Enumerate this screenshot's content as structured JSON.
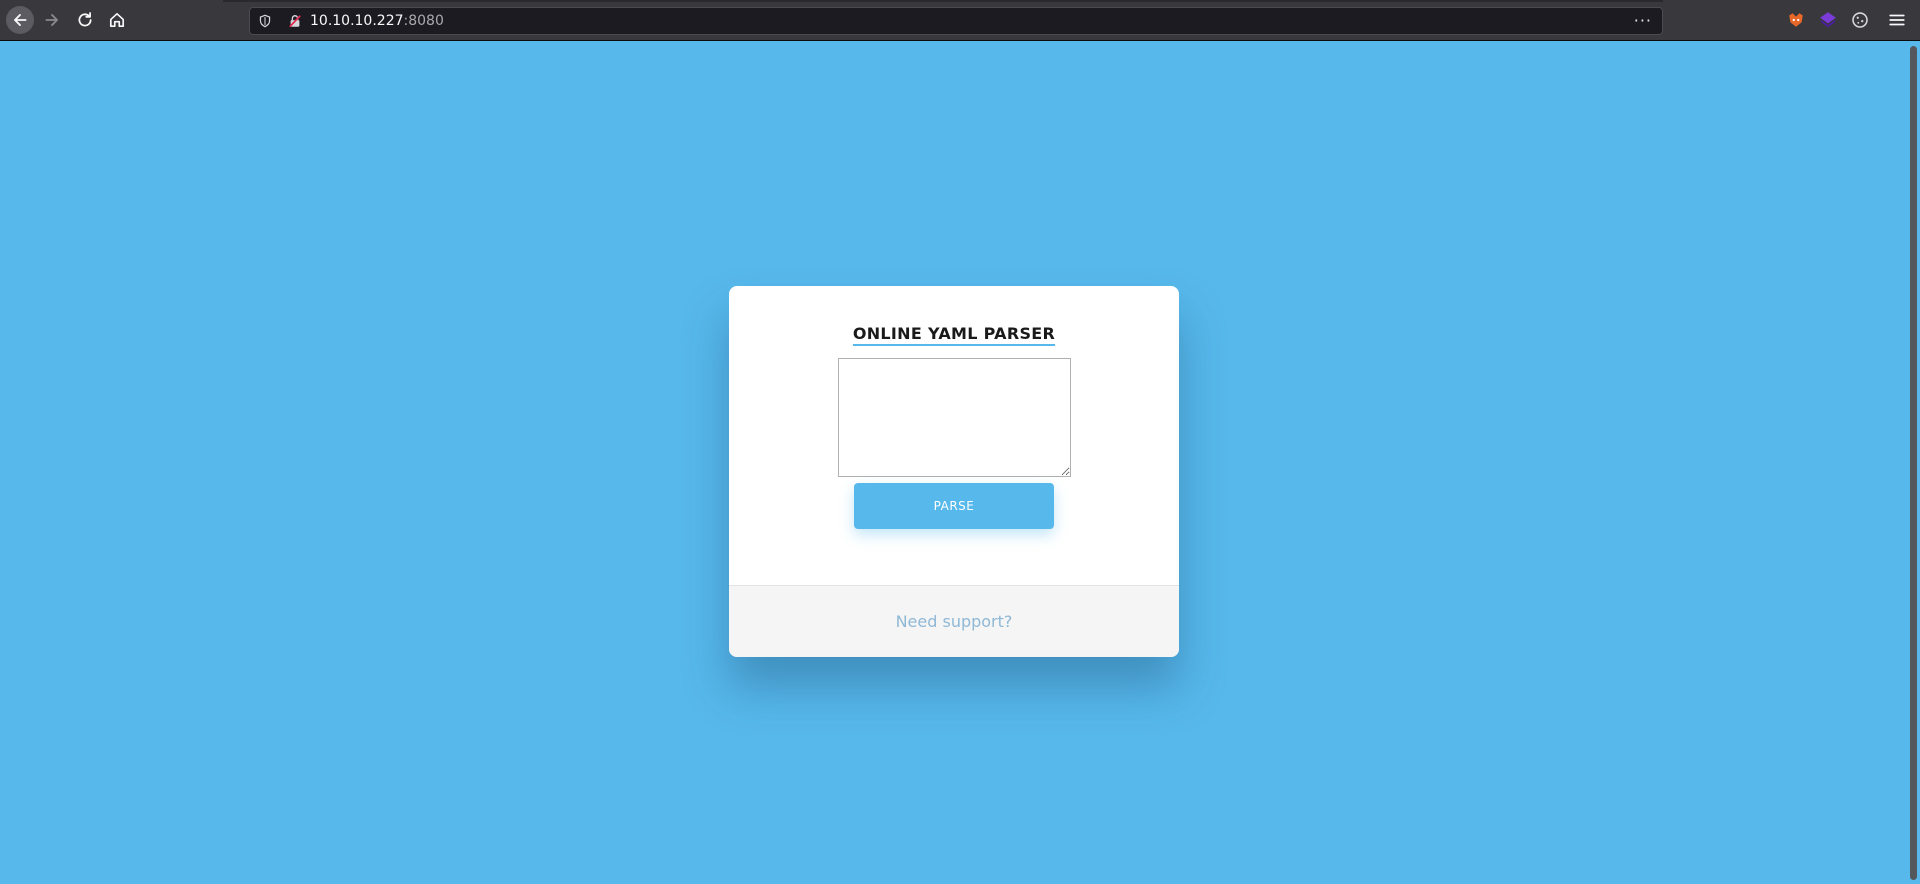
{
  "browser": {
    "url_host": "10.10.10.227",
    "url_port": ":8080",
    "more_label": "···"
  },
  "page": {
    "title": "ONLINE YAML PARSER",
    "textarea_value": "",
    "parse_button_label": "PARSE",
    "support_link_label": "Need support?"
  },
  "colors": {
    "background": "#57b8eb",
    "card": "#ffffff",
    "button": "#57b8eb",
    "footer": "#f5f5f5",
    "link": "#8fb8d6"
  },
  "icons": {
    "nav": [
      "back-arrow-icon",
      "forward-arrow-icon",
      "reload-icon",
      "home-icon"
    ],
    "urlbar": [
      "shield-icon",
      "insecure-lock-icon",
      "more-options-icon"
    ],
    "extensions": [
      "foxyproxy-icon",
      "wappalyzer-icon",
      "cookie-icon",
      "hamburger-menu-icon"
    ]
  }
}
